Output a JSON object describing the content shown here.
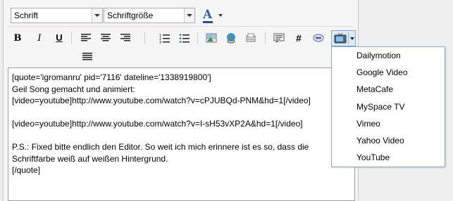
{
  "toolbar": {
    "font_select": {
      "value": "Schrift"
    },
    "size_select": {
      "value": "Schriftgröße"
    },
    "buttons": {
      "bold": "B",
      "italic": "I",
      "underline": "U",
      "hashtag": "#"
    }
  },
  "editor": {
    "lines": [
      "[quote='igromanru' pid='7116' dateline='1338919800']",
      "Geil Song gemacht und animiert:",
      "[video=youtube]http://www.youtube.com/watch?v=cPJUBQd-PNM&hd=1[/video]",
      "",
      "[video=youtube]http://www.youtube.com/watch?v=I-sH53vXP2A&hd=1[/video]",
      "",
      "P.S.: Fixed bitte endlich den Editor. So weit ich mich erinnere ist es so, dass die",
      "Schriftfarbe weiß auf weißen Hintergrund.",
      "[/quote]"
    ]
  },
  "video_menu": {
    "items": [
      "Dailymotion",
      "Google Video",
      "MetaCafe",
      "MySpace TV",
      "Vimeo",
      "Yahoo Video",
      "YouTube"
    ]
  },
  "colors": {
    "accent_border": "#7fa4cf",
    "accent_fill": "#dce9f7"
  }
}
